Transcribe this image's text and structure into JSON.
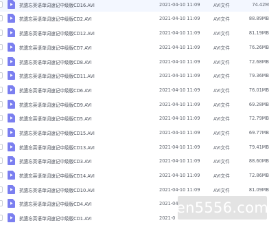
{
  "files": [
    {
      "name": "抗遗忘英语单词速记中级版CD16.AVI",
      "date": "2021-04-10 11:09",
      "type": "AVI文件",
      "size": "74.42M"
    },
    {
      "name": "抗遗忘英语单词速记中级版CD2.AVI",
      "date": "2021-04-10 11:09",
      "type": "AVI文件",
      "size": "88.89MB"
    },
    {
      "name": "抗遗忘英语单词速记中级版CD12.AVI",
      "date": "2021-04-10 11:09",
      "type": "AVI文件",
      "size": "81.19MB"
    },
    {
      "name": "抗遗忘英语单词速记中级版CD7.AVI",
      "date": "2021-04-10 11:09",
      "type": "AVI文件",
      "size": "76.26MB"
    },
    {
      "name": "抗遗忘英语单词速记中级版CD8.AVI",
      "date": "2021-04-10 11:09",
      "type": "AVI文件",
      "size": "72.68MB"
    },
    {
      "name": "抗遗忘英语单词速记中级版CD11.AVI",
      "date": "2021-04-10 11:09",
      "type": "AVI文件",
      "size": "79.36MB"
    },
    {
      "name": "抗遗忘英语单词速记中级版CD6.AVI",
      "date": "2021-04-10 11:09",
      "type": "AVI文件",
      "size": "76.01MB"
    },
    {
      "name": "抗遗忘英语单词速记中级版CD9.AVI",
      "date": "2021-04-10 11:09",
      "type": "AVI文件",
      "size": "69.28MB"
    },
    {
      "name": "抗遗忘英语单词速记中级版CD5.AVI",
      "date": "2021-04-10 11:09",
      "type": "AVI文件",
      "size": "72.79MB"
    },
    {
      "name": "抗遗忘英语单词速记中级版CD15.AVI",
      "date": "2021-04-10 11:09",
      "type": "AVI文件",
      "size": "69.77MB"
    },
    {
      "name": "抗遗忘英语单词速记中级版CD13.AVI",
      "date": "2021-04-10 11:09",
      "type": "AVI文件",
      "size": "79.41MB"
    },
    {
      "name": "抗遗忘英语单词速记中级版CD3.AVI",
      "date": "2021-04-10 11:09",
      "type": "AVI文件",
      "size": "88.60MB"
    },
    {
      "name": "抗遗忘英语单词速记中级版CD14.AVI",
      "date": "2021-04-10 11:09",
      "type": "AVI文件",
      "size": "72.86MB"
    },
    {
      "name": "抗遗忘英语单词速记中级版CD10.AVI",
      "date": "2021-04-10 11:09",
      "type": "AVI文件",
      "size": "81.09MB"
    },
    {
      "name": "抗遗忘英语单词速记中级版CD4.AVI",
      "date": "2021-04",
      "type": "",
      "size": ""
    },
    {
      "name": "抗遗忘英语单词速记中级版CD1.AVI",
      "date": "2021-0",
      "type": "",
      "size": ""
    }
  ],
  "icons": {
    "file": "video-file-icon",
    "checkbox": "checkbox-icon"
  },
  "colors": {
    "file_icon": "#7b7ff0",
    "text": "#4a4f5a",
    "watermark_bg": "#e1e1e1"
  },
  "watermark": {
    "text": "en5556.com"
  }
}
